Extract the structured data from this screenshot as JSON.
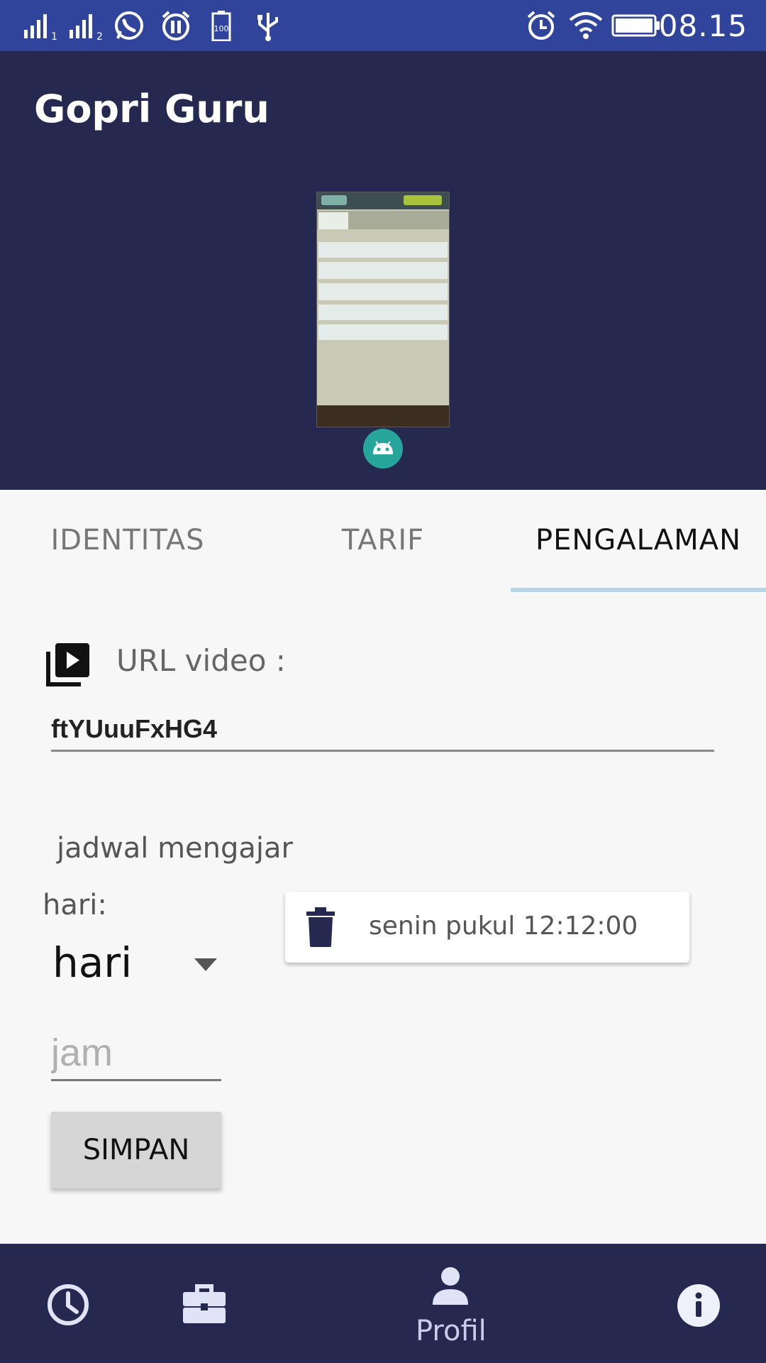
{
  "status_bar": {
    "time": "08.15",
    "battery_level": "100",
    "icons": [
      "signal-1-icon",
      "signal-2-icon",
      "whatsapp-icon",
      "alarm-paused-icon",
      "battery-icon",
      "usb-icon",
      "alarm-icon",
      "wifi-icon",
      "battery-full-icon"
    ]
  },
  "app": {
    "title": "Gopri Guru"
  },
  "header": {
    "image": "screenshot-thumbnail",
    "badge_icon": "android-icon",
    "accent": "#26a69a"
  },
  "tabs": [
    {
      "label": "IDENTITAS",
      "active": false
    },
    {
      "label": "TARIF",
      "active": false
    },
    {
      "label": "PENGALAMAN",
      "active": true
    }
  ],
  "video": {
    "icon": "video-library-icon",
    "label": "URL video :",
    "value": "ftYUuuFxHG4"
  },
  "schedule": {
    "section_label": "jadwal mengajar",
    "day_label": "hari:",
    "day_selected": "hari",
    "hour_placeholder": "jam",
    "save_label": "SIMPAN",
    "entries": [
      {
        "icon": "trash-icon",
        "text": "senin pukul 12:12:00"
      }
    ]
  },
  "bottom_nav": {
    "items": [
      {
        "icon": "clock-icon",
        "label": ""
      },
      {
        "icon": "briefcase-icon",
        "label": ""
      },
      {
        "icon": "person-icon",
        "label": "Profil",
        "active": true
      },
      {
        "icon": "info-icon",
        "label": ""
      }
    ]
  },
  "colors": {
    "status_bar": "#30449b",
    "primary_dark": "#25284f",
    "tab_indicator": "#b7d3e6",
    "background": "#f7f7f7"
  }
}
